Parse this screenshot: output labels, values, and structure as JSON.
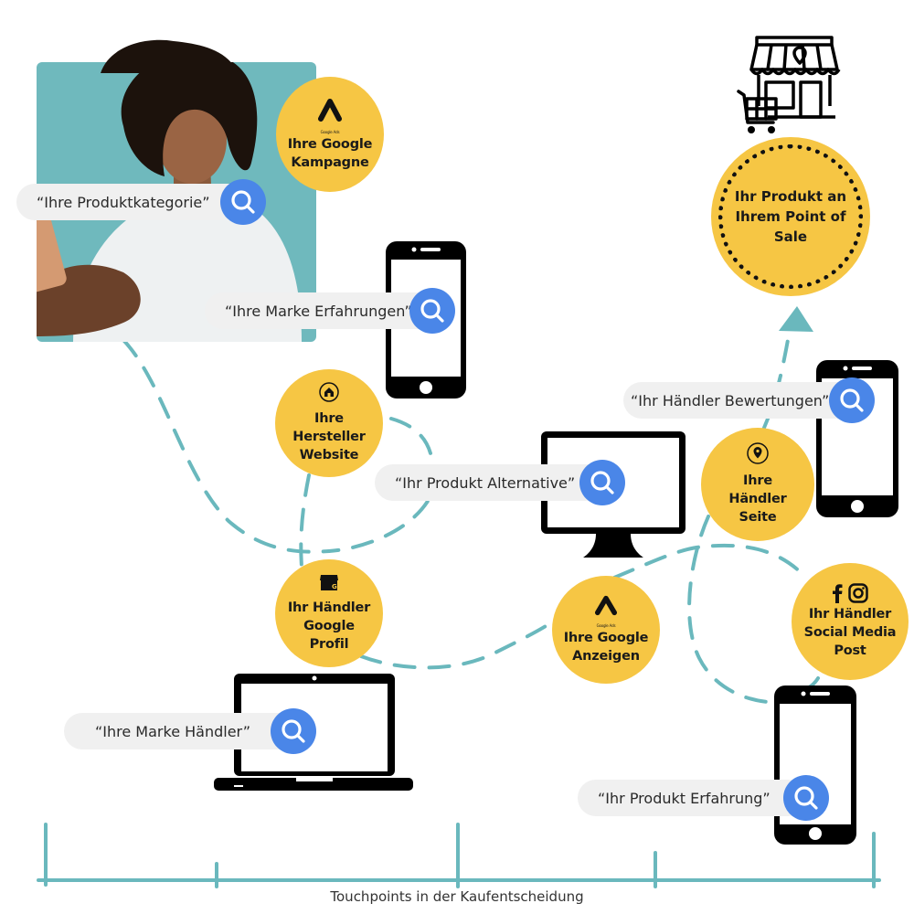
{
  "diagram": {
    "title": "Touchpoints in der Kaufentscheidung",
    "accent_colors": {
      "path": "#6ab8bd",
      "touchpoint": "#f6c644",
      "search_button": "#4a86e8",
      "search_bar": "#f0f0f0",
      "photo_background": "#6fb9bd"
    },
    "searches": [
      {
        "query": "“Ihre Produktkategorie”",
        "icon": "search-icon"
      },
      {
        "query": "“Ihre Marke Erfahrungen”",
        "icon": "search-icon"
      },
      {
        "query": "“Ihr Produkt Alternative”",
        "icon": "search-icon"
      },
      {
        "query": "“Ihr Händler Bewertungen”",
        "icon": "search-icon"
      },
      {
        "query": "“Ihre Marke Händler”",
        "icon": "search-icon"
      },
      {
        "query": "“Ihr Produkt Erfahrung”",
        "icon": "search-icon"
      }
    ],
    "touchpoints": [
      {
        "label": "Ihre Google\nKampagne",
        "icon": "google-ads-icon",
        "icon_caption": "Google Ads"
      },
      {
        "label": "Ihre\nHersteller\nWebsite",
        "icon": "home-icon"
      },
      {
        "label": "Ihr Händler\nGoogle\nProfil",
        "icon": "google-business-profile-icon"
      },
      {
        "label": "Ihre Google\nAnzeigen",
        "icon": "google-ads-icon",
        "icon_caption": "Google Ads"
      },
      {
        "label": "Ihre\nHändler\nSeite",
        "icon": "location-pin-icon"
      },
      {
        "label": "Ihr Händler\nSocial Media\nPost",
        "icon": "facebook-instagram-icon"
      }
    ],
    "destination": {
      "label": "Ihr Produkt an\nIhrem Point of\nSale",
      "icon": "shop-with-cart-icon"
    },
    "devices": [
      "smartphone",
      "desktop-monitor",
      "smartphone",
      "laptop",
      "smartphone"
    ],
    "timeline": {
      "label": "Touchpoints in der Kaufentscheidung",
      "ticks": 5
    }
  }
}
